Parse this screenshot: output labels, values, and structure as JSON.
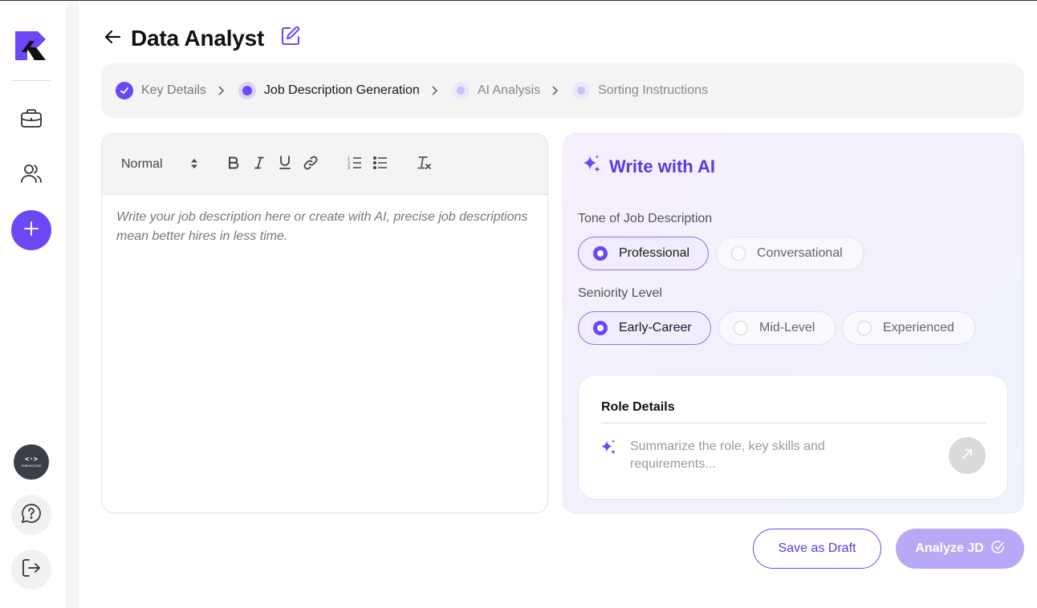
{
  "colors": {
    "accent": "#6c47f5",
    "accent_light": "#b9a8f5",
    "ai_title": "#5b3ae0"
  },
  "sidebar": {
    "items": [
      {
        "icon": "briefcase-icon"
      },
      {
        "icon": "users-icon"
      },
      {
        "icon": "plus-icon"
      }
    ],
    "avatar": {
      "top": "<·>",
      "bottom": "VIBENCODE"
    },
    "help_icon": "help-chat-icon",
    "logout_icon": "logout-icon"
  },
  "header": {
    "title": "Data Analyst"
  },
  "stepper": {
    "steps": [
      {
        "label": "Key Details",
        "state": "done"
      },
      {
        "label": "Job Description Generation",
        "state": "active"
      },
      {
        "label": "AI Analysis",
        "state": "pending"
      },
      {
        "label": "Sorting Instructions",
        "state": "pending"
      }
    ]
  },
  "editor": {
    "format_value": "Normal",
    "placeholder": "Write your job description here or create with AI, precise job descriptions mean better hires in less time."
  },
  "ai": {
    "title": "Write with AI",
    "tone_label": "Tone of Job Description",
    "tone_options": [
      "Professional",
      "Conversational"
    ],
    "tone_selected": "Professional",
    "seniority_label": "Seniority Level",
    "seniority_options": [
      "Early-Career",
      "Mid-Level",
      "Experienced"
    ],
    "seniority_selected": "Early-Career",
    "role_title": "Role Details",
    "role_placeholder": "Summarize the role, key skills and requirements..."
  },
  "actions": {
    "save_draft": "Save as Draft",
    "analyze": "Analyze JD"
  }
}
